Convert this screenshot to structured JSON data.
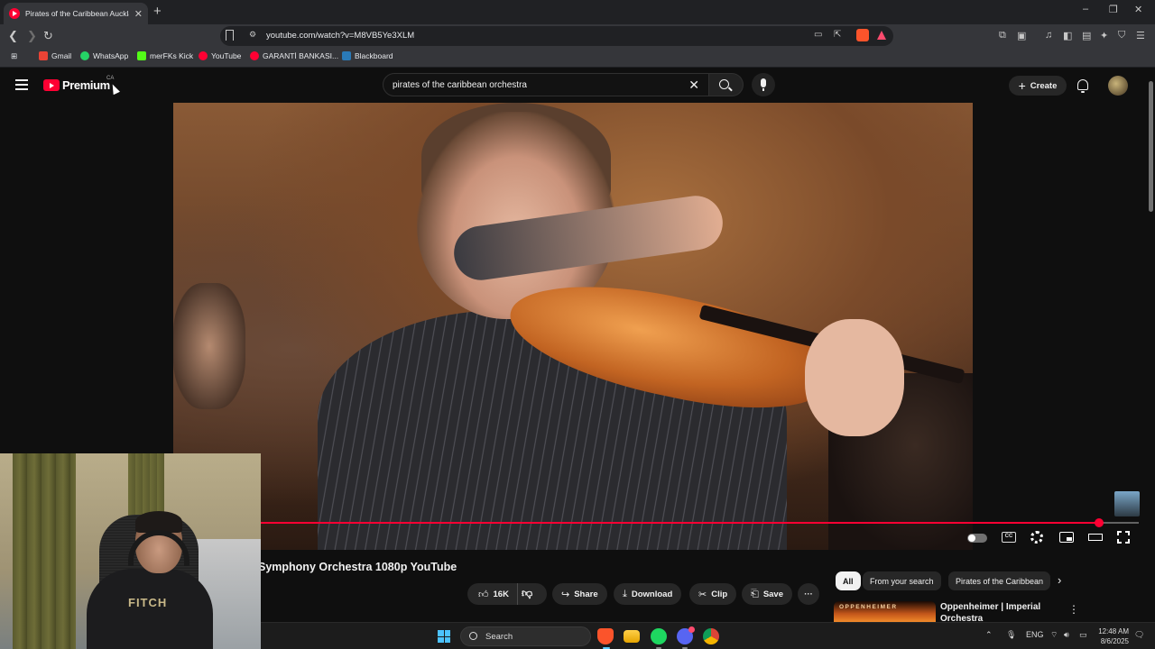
{
  "browser": {
    "tab_title": "Pirates of the Caribbean Auckland",
    "tab_close": "✕",
    "new_tab": "+",
    "window_controls": {
      "minimize": "–",
      "restore": "❐",
      "close": "✕"
    },
    "url": "youtube.com/watch?v=M8VB5Ye3XLM",
    "bookmarks": [
      {
        "label": "Gmail",
        "color": "#ea4335"
      },
      {
        "label": "WhatsApp",
        "color": "#25d366"
      },
      {
        "label": "merFKs Kick",
        "color": "#53fc18"
      },
      {
        "label": "YouTube",
        "color": "#ff0033"
      },
      {
        "label": "GARANTİ BANKASI...",
        "color": "#ff0033"
      },
      {
        "label": "Blackboard",
        "color": "#2a7ab8"
      }
    ]
  },
  "youtube": {
    "brand": "Premium",
    "region": "CA",
    "search_query": "pirates of the caribbean orchestra",
    "search_clear": "✕",
    "create_label": "Create",
    "create_plus": "+",
    "video": {
      "title": "Symphony Orchestra 1080p YouTube",
      "progress": 0.955
    },
    "actions": {
      "like_count": "16K",
      "share": "Share",
      "download": "Download",
      "clip": "Clip",
      "save": "Save",
      "more": "···"
    },
    "cc_label": "CC",
    "chips": [
      "All",
      "From your search",
      "Pirates of the Caribbean"
    ],
    "recommendation": {
      "thumb_text": "OPPENHEIMER",
      "title": "Oppenheimer | Imperial Orchestra"
    }
  },
  "webcam": {
    "shirt_print": "FITCH"
  },
  "taskbar": {
    "search_label": "Search",
    "language": "ENG",
    "time": "12:48 AM",
    "date": "8/6/2025"
  },
  "colors": {
    "accent_red": "#ff0033",
    "background": "#0f0f0f"
  }
}
